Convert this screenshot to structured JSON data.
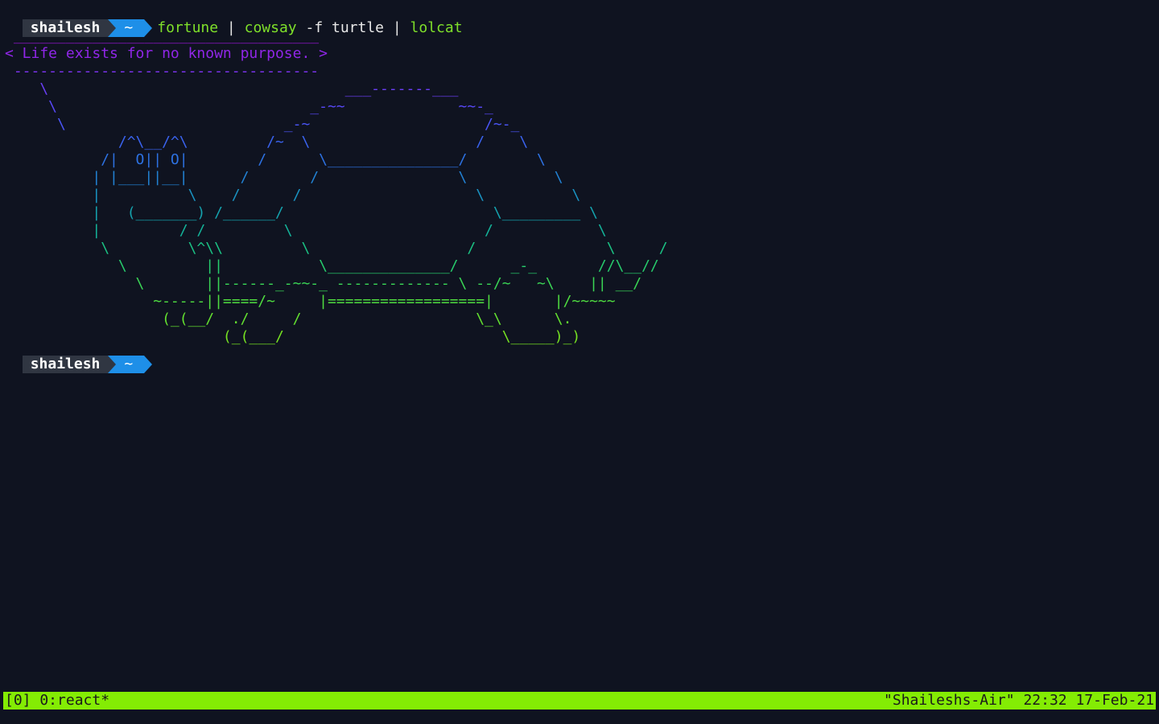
{
  "prompt": {
    "user": "shailesh",
    "dir": "~"
  },
  "command": {
    "part1": "fortune",
    "pipe1": " | ",
    "part2": "cowsay",
    "part3": " -f turtle",
    "pipe2": " | ",
    "part4": "lolcat"
  },
  "art": {
    "lines": [
      {
        "text": " ___________________________________",
        "color": "#9a16d8"
      },
      {
        "text": "< Life exists for no known purpose. >",
        "color": "#9026e8"
      },
      {
        "text": " -----------------------------------",
        "color": "#7c34f0"
      },
      {
        "text": "    \\                                  ___-------___",
        "color": "#6a3ef5"
      },
      {
        "text": "     \\                             _-~~             ~~-_",
        "color": "#5848f8"
      },
      {
        "text": "      \\                         _-~                    /~-_",
        "color": "#4a55f6"
      },
      {
        "text": "             /^\\__/^\\         /~  \\                   /    \\",
        "color": "#3a63ee"
      },
      {
        "text": "           /|  O|| O|        /      \\_______________/        \\",
        "color": "#2d72e3"
      },
      {
        "text": "          | |___||__|      /       /                \\          \\",
        "color": "#2282d4"
      },
      {
        "text": "          |          \\    /      /                    \\          \\",
        "color": "#1a93c2"
      },
      {
        "text": "          |   (_______) /______/                        \\_________ \\",
        "color": "#15a3ae"
      },
      {
        "text": "          |         / /         \\                      /            \\",
        "color": "#14b399"
      },
      {
        "text": "           \\         \\^\\\\         \\                  /               \\     /",
        "color": "#1bc183"
      },
      {
        "text": "             \\         ||           \\______________/      _-_       //\\__//",
        "color": "#27cc6c"
      },
      {
        "text": "               \\       ||------_-~~-_ ------------- \\ --/~   ~\\    || __/",
        "color": "#3ad555"
      },
      {
        "text": "                 ~-----||====/~     |==================|       |/~~~~~",
        "color": "#4fdc40"
      },
      {
        "text": "                  (_(__/  ./     /                    \\_\\      \\.",
        "color": "#63e030"
      },
      {
        "text": "                         (_(___/                         \\_____)_)",
        "color": "#76e222"
      }
    ]
  },
  "status": {
    "left": "[0] 0:react*",
    "right": "\"Shaileshs-Air\" 22:32 17-Feb-21"
  },
  "colors": {
    "background": "#0f1320",
    "status_bar": "#84ec04",
    "prompt_user_bg": "#303642",
    "prompt_dir_bg": "#1e8fe8",
    "command_green": "#7fe02a"
  }
}
